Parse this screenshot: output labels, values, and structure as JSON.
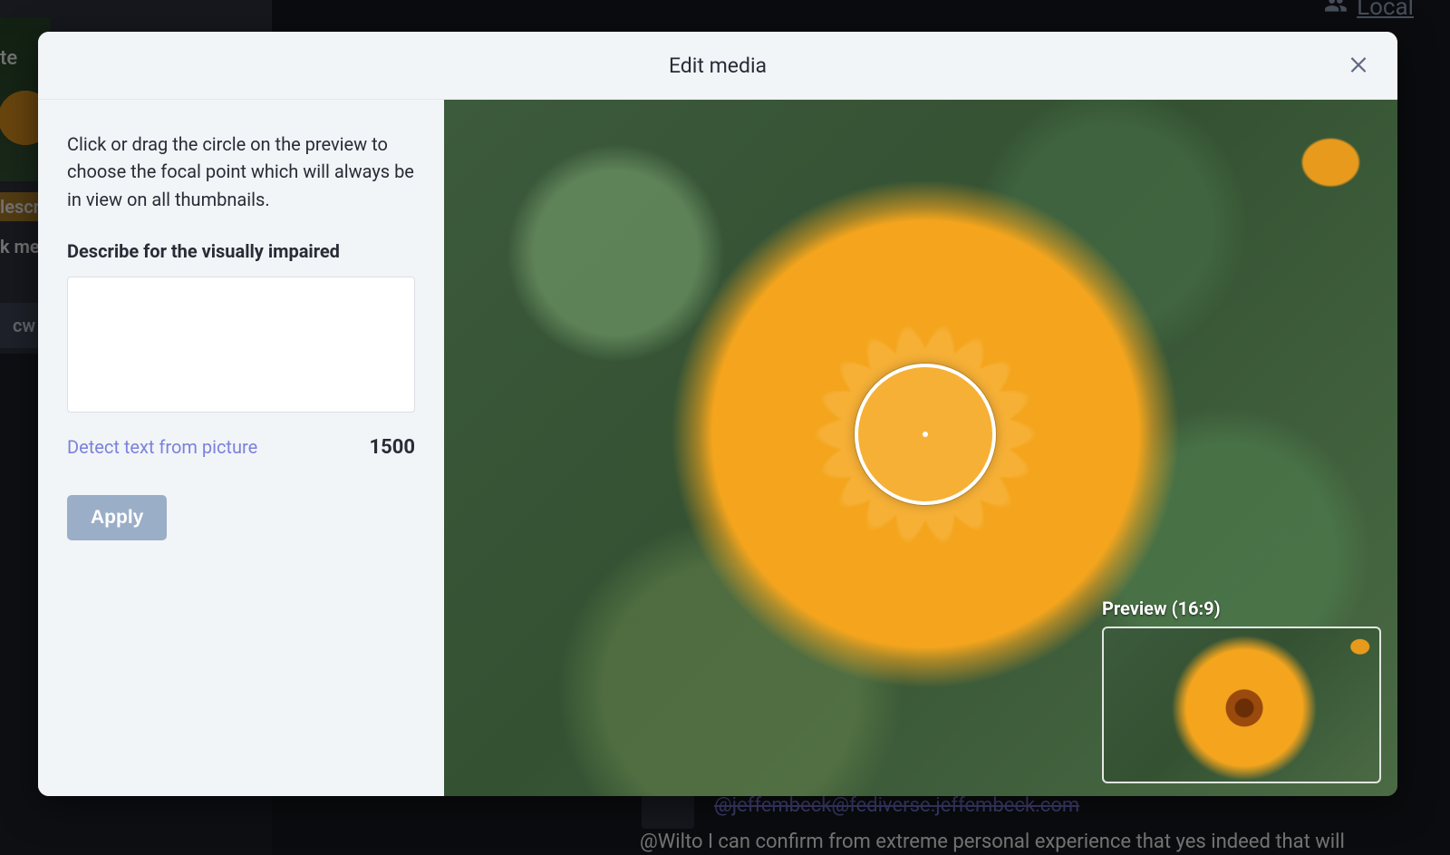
{
  "background": {
    "local_link": "Local",
    "sidebar_fragments": {
      "te": "te",
      "lescr": "lescr",
      "k_me": "k me",
      "cw": "cw"
    },
    "handle_strikethrough": "@jeffembeck@fediverse.jeffembeck.com",
    "truncated_caption": "@Wilto I can confirm from extreme personal experience that yes indeed that will"
  },
  "modal": {
    "title": "Edit media",
    "instructions": "Click or drag the circle on the preview to choose the focal point which will always be in view on all thumbnails.",
    "alt_label": "Describe for the visually impaired",
    "alt_value": "",
    "detect_link": "Detect text from picture",
    "char_count": "1500",
    "apply_label": "Apply",
    "preview_label": "Preview (16:9)"
  }
}
